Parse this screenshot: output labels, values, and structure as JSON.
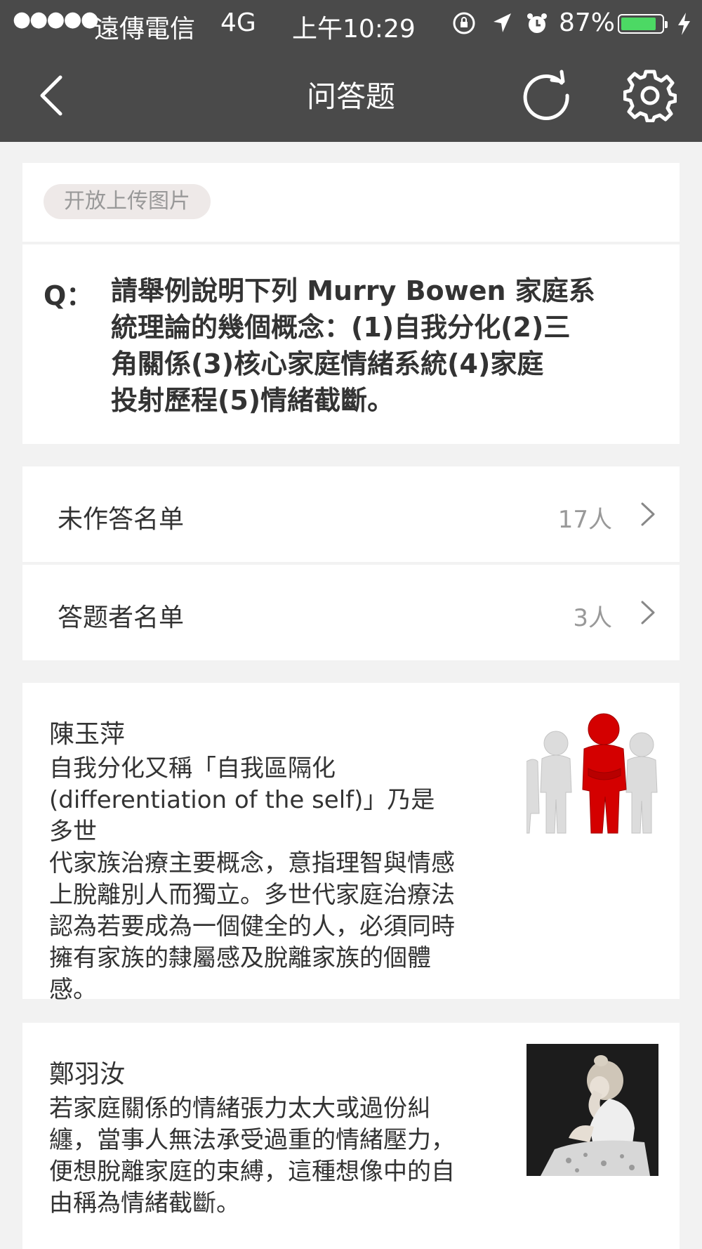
{
  "status_bar": {
    "signal_dots": "●●●●●",
    "carrier": "遠傳電信",
    "network": "4G",
    "time": "上午10:29",
    "battery_percent": "87%",
    "battery_level": 0.87,
    "icons": [
      "orientation-lock-icon",
      "location-arrow-icon",
      "alarm-icon",
      "battery-icon",
      "charging-bolt-icon"
    ]
  },
  "nav": {
    "title": "问答题",
    "icons": [
      "back-chevron-icon",
      "refresh-icon",
      "gear-icon"
    ]
  },
  "tag": {
    "label": "开放上传图片"
  },
  "question": {
    "prefix": "Q：",
    "lines": [
      "請舉例說明下列 Murry Bowen 家庭系",
      "統理論的幾個概念：(1)自我分化(2)三",
      "角關係(3)核心家庭情緒系統(4)家庭",
      "投射歷程(5)情緒截斷。"
    ]
  },
  "rows": [
    {
      "label": "未作答名单",
      "count": "17人"
    },
    {
      "label": "答题者名单",
      "count": "3人"
    }
  ],
  "answers": [
    {
      "name": "陳玉萍",
      "lines": [
        "自我分化又稱「自我區隔化",
        "(differentiation of the self)」乃是多世",
        "代家族治療主要概念，意指理智與情感",
        "上脫離別人而獨立。多世代家庭治療法",
        "認為若要成為一個健全的人，必須同時",
        "擁有家族的隸屬感及脫離家族的個體",
        "感。"
      ],
      "image": "red-figure-among-white-figures"
    },
    {
      "name": "鄭羽汝",
      "lines": [
        "若家庭關係的情緒張力太大或過份糾",
        "纏，當事人無法承受過重的情緒壓力，",
        "便想脫離家庭的束縛，這種想像中的自",
        "由稱為情緒截斷。"
      ],
      "image": "distressed-woman-photo"
    }
  ],
  "colors": {
    "bar": "#4a4a4a",
    "background": "#f2f2f2",
    "battery": "#4cd964",
    "accent_red": "#d40000"
  }
}
